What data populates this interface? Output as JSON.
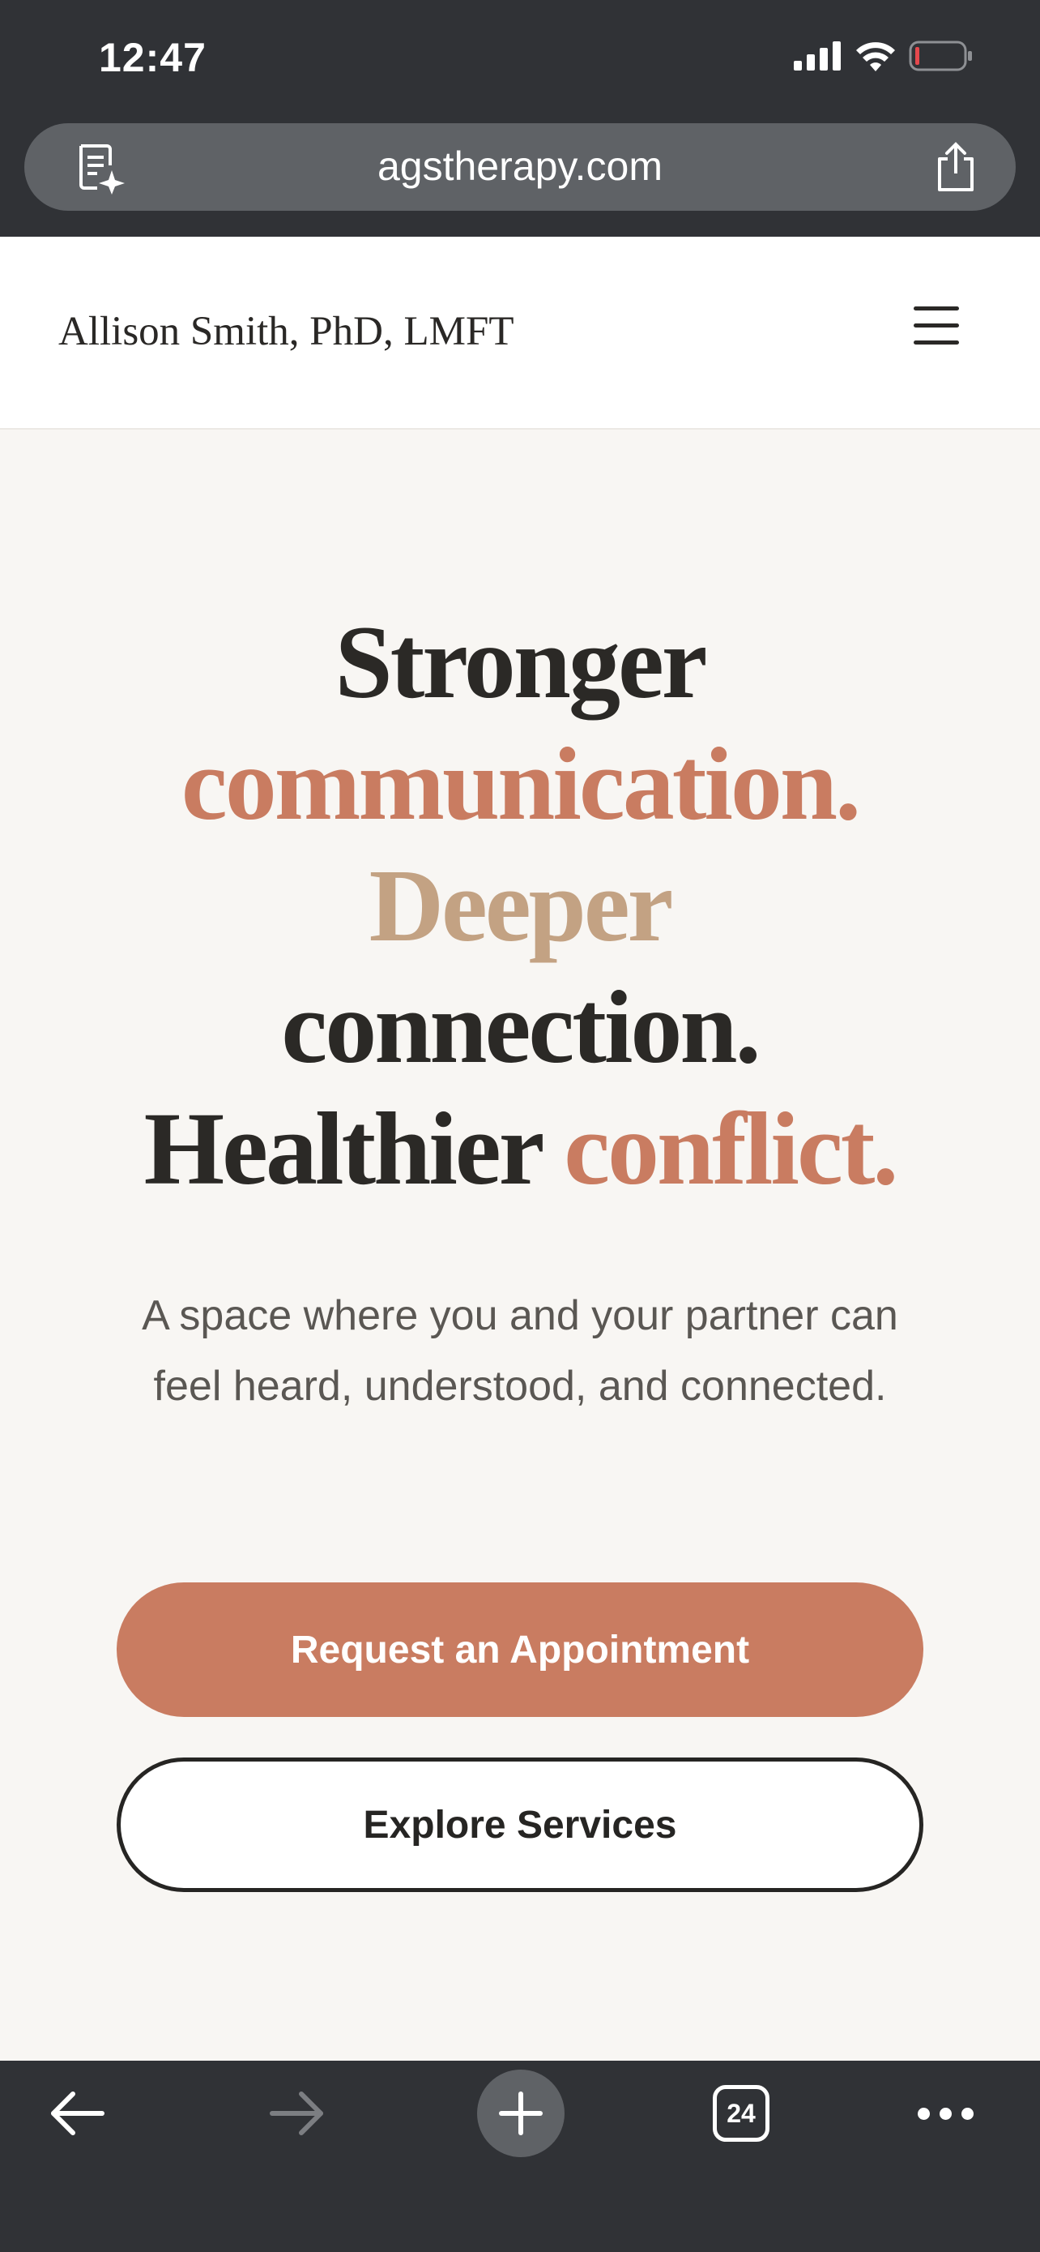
{
  "status_bar": {
    "time": "12:47",
    "icons": [
      "signal-icon",
      "wifi-icon",
      "battery-icon"
    ]
  },
  "browser": {
    "url": "agstherapy.com",
    "reader_icon": "reader-mode-icon",
    "share_icon": "share-icon"
  },
  "header": {
    "brand": "Allison Smith, PhD, LMFT",
    "menu_icon": "hamburger-menu-icon"
  },
  "hero": {
    "headline": {
      "line1": "Stronger",
      "line2": "communication.",
      "line3": "Deeper",
      "line4": "connection.",
      "line5_word1": "Healthier",
      "line5_word2": "conflict."
    },
    "tagline": "A space where you and your partner can feel heard, understood, and connected.",
    "primary_button": "Request an Appointment",
    "secondary_button": "Explore Services"
  },
  "toolbar": {
    "tab_count": "24",
    "icons": [
      "back-arrow-icon",
      "forward-arrow-icon",
      "new-tab-plus-icon",
      "tabs-icon",
      "more-icon"
    ]
  },
  "colors": {
    "accent_terracotta": "#c97c61",
    "accent_tan": "#c3a283",
    "text_dark": "#2b2926",
    "page_bg": "#f8f6f3",
    "chrome_bg": "#303236"
  }
}
